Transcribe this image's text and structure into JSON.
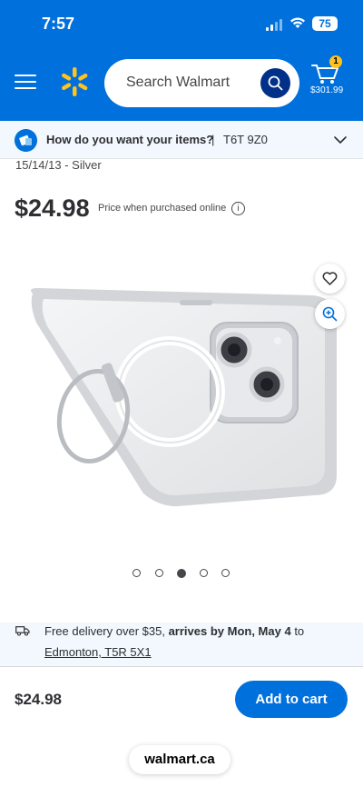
{
  "status_bar": {
    "time": "7:57",
    "battery": "75"
  },
  "header": {
    "search_placeholder": "Search Walmart",
    "cart_count": "1",
    "cart_total": "$301.99",
    "colors": {
      "brand_blue": "#0071dc",
      "spark_yellow": "#ffc220",
      "search_button": "#003087"
    }
  },
  "delivery_bar": {
    "question": "How do you want your items?",
    "separator": "|",
    "postal_code": "T6T 9Z0"
  },
  "product": {
    "title_fragment": "15/14/13 - Silver",
    "price": "$24.98",
    "price_note": "Price when purchased online",
    "image_count": 5,
    "active_image_index": 2
  },
  "shipping": {
    "prefix": "Free delivery over $35, ",
    "arrival": "arrives by Mon, May 4",
    "suffix": " to",
    "location": "Edmonton, T5R 5X1"
  },
  "footer": {
    "price": "$24.98",
    "add_to_cart": "Add to cart"
  },
  "browser": {
    "url": "walmart.ca"
  },
  "icons": [
    "menu-icon",
    "walmart-spark-logo",
    "search-icon",
    "cart-icon",
    "delivery-icon",
    "chevron-down-icon",
    "info-icon",
    "heart-icon",
    "zoom-icon",
    "truck-icon"
  ]
}
